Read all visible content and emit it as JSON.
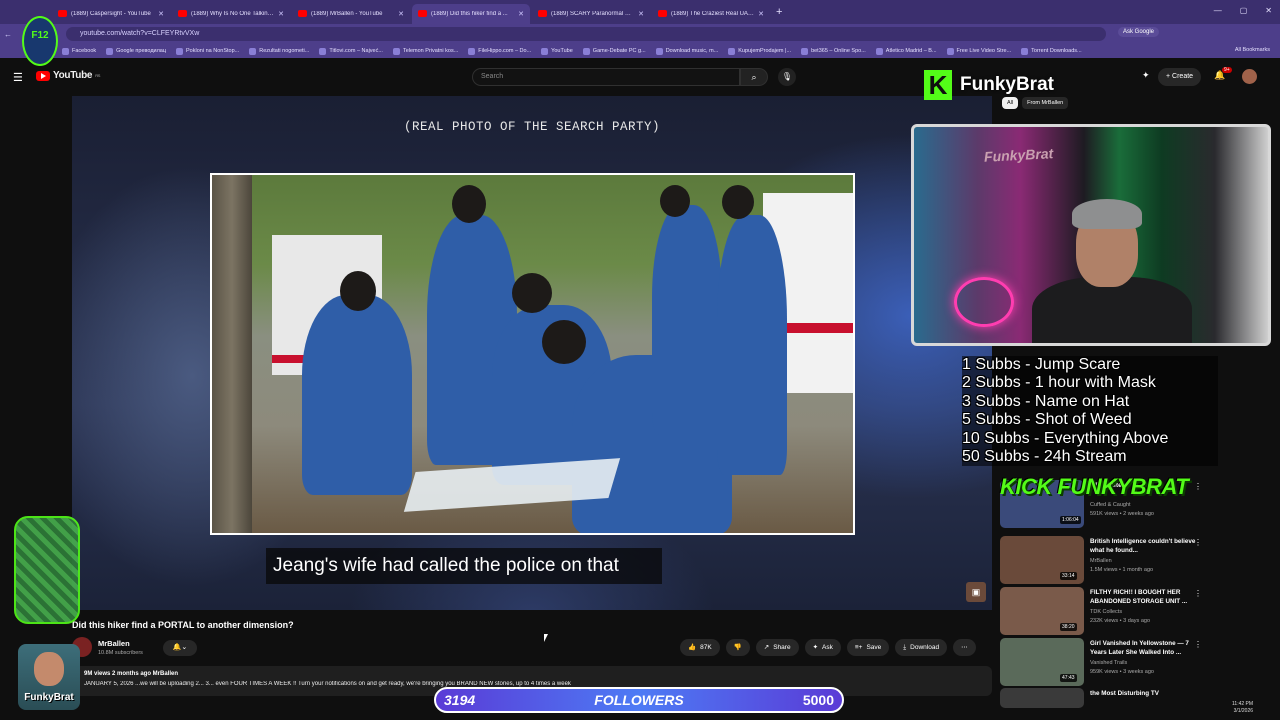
{
  "browser": {
    "tabs": [
      {
        "title": "(1889) Caspersight - YouTube",
        "active": false
      },
      {
        "title": "(1889) Why Is No One Talking A...",
        "active": false
      },
      {
        "title": "(1889) MrBallen - YouTube",
        "active": false
      },
      {
        "title": "(1889) Did this hiker find a ...",
        "active": true
      },
      {
        "title": "(1889) SCARY Paranormal Clips",
        "active": false
      },
      {
        "title": "(1889) The Craziest Real UAP C...",
        "active": false
      }
    ],
    "url": "youtube.com/watch?v=CLFEYRtvVXw",
    "ask_google": "Ask Google",
    "bookmarks": [
      "Facebook",
      "Google преводилац",
      "Pokloni na NonStop...",
      "Rezultati nogometi...",
      "Titlovi.com – Najveć...",
      "Telemon Privatni kos...",
      "FileHippo.com – Do...",
      "YouTube",
      "Game-Debate PC g...",
      "Download music, m...",
      "KupujemProdajem |...",
      "bet365 – Online Spo...",
      "Atletico Madrid – B...",
      "Free Live Video Stre...",
      "Torrent Downloads..."
    ],
    "all_bookmarks": "All Bookmarks"
  },
  "youtube": {
    "logo_text": "YouTube",
    "logo_region": "RS",
    "search_placeholder": "Search",
    "create_label": "Create",
    "notif_count": "9+",
    "video": {
      "photo_caption": "(REAL PHOTO OF THE SEARCH PARTY)",
      "subtitle": "Jeang's wife had called the police on that",
      "title": "Did this hiker find a PORTAL to another dimension?"
    },
    "channel": {
      "name": "MrBallen",
      "subs": "10.8M subscribers"
    },
    "actions": {
      "likes": "87K",
      "share": "Share",
      "ask": "Ask",
      "save": "Save",
      "download": "Download"
    },
    "description": {
      "meta": "9M views  2 months ago  MrBallen",
      "text": "JANUARY 5, 2026 ...we will be uploading 2... 3... even FOUR TIMES A WEEK !! Turn your notifications on and get ready, we're bringing you BRAND NEW stories, up to 4 times a week"
    },
    "chips": [
      "All",
      "From MrBallen"
    ],
    "recommendations": [
      {
        "title": "...Fale After",
        "channel": "Cuffed & Caught",
        "meta": "591K views • 2 weeks ago",
        "duration": "1:06:04",
        "color": "#3a4a7a"
      },
      {
        "title": "British Intelligence couldn't believe what he found...",
        "channel": "MrBallen",
        "meta": "1.5M views • 1 month ago",
        "duration": "33:14",
        "color": "#6a4a3a"
      },
      {
        "title": "FILTHY RICH!! I BOUGHT HER ABANDONED STORAGE UNIT ...",
        "channel": "TDK Collects",
        "meta": "232K views • 3 days ago",
        "duration": "38:20",
        "color": "#7a5a4a"
      },
      {
        "title": "Girl Vanished In Yellowstone — 7 Years Later She Walked Into ...",
        "channel": "Vanished Trails",
        "meta": "959K views • 3 weeks ago",
        "duration": "47:43",
        "color": "#5a6a5a"
      },
      {
        "title": "the Most Disturbing TV",
        "channel": "",
        "meta": "",
        "duration": "",
        "color": "#3a3a3a"
      }
    ]
  },
  "overlay": {
    "brand": "FunkyBrat",
    "webcam_sign": "FunkyBrat",
    "left_logo": "F12",
    "goals": [
      "1 Subbs - Jump Scare",
      "2 Subbs - 1 hour with Mask",
      "3 Subbs - Name on Hat",
      "5 Subbs - Shot of Weed",
      "10 Subbs - Everything Above",
      "50 Subbs - 24h Stream"
    ],
    "kick_banner": "KICK FUNKYBRAT",
    "followers_count": "3194",
    "followers_label": "FOLLOWERS",
    "followers_goal": "5000",
    "avatar_name": "FunkyBrat",
    "followers_progress": 0.6388
  },
  "system": {
    "time": "11:42 PM",
    "date": "3/1/2026"
  },
  "colors": {
    "kick_green": "#53fc18",
    "browser_purple": "#4d3e8a",
    "yt_red": "#ff0000"
  }
}
